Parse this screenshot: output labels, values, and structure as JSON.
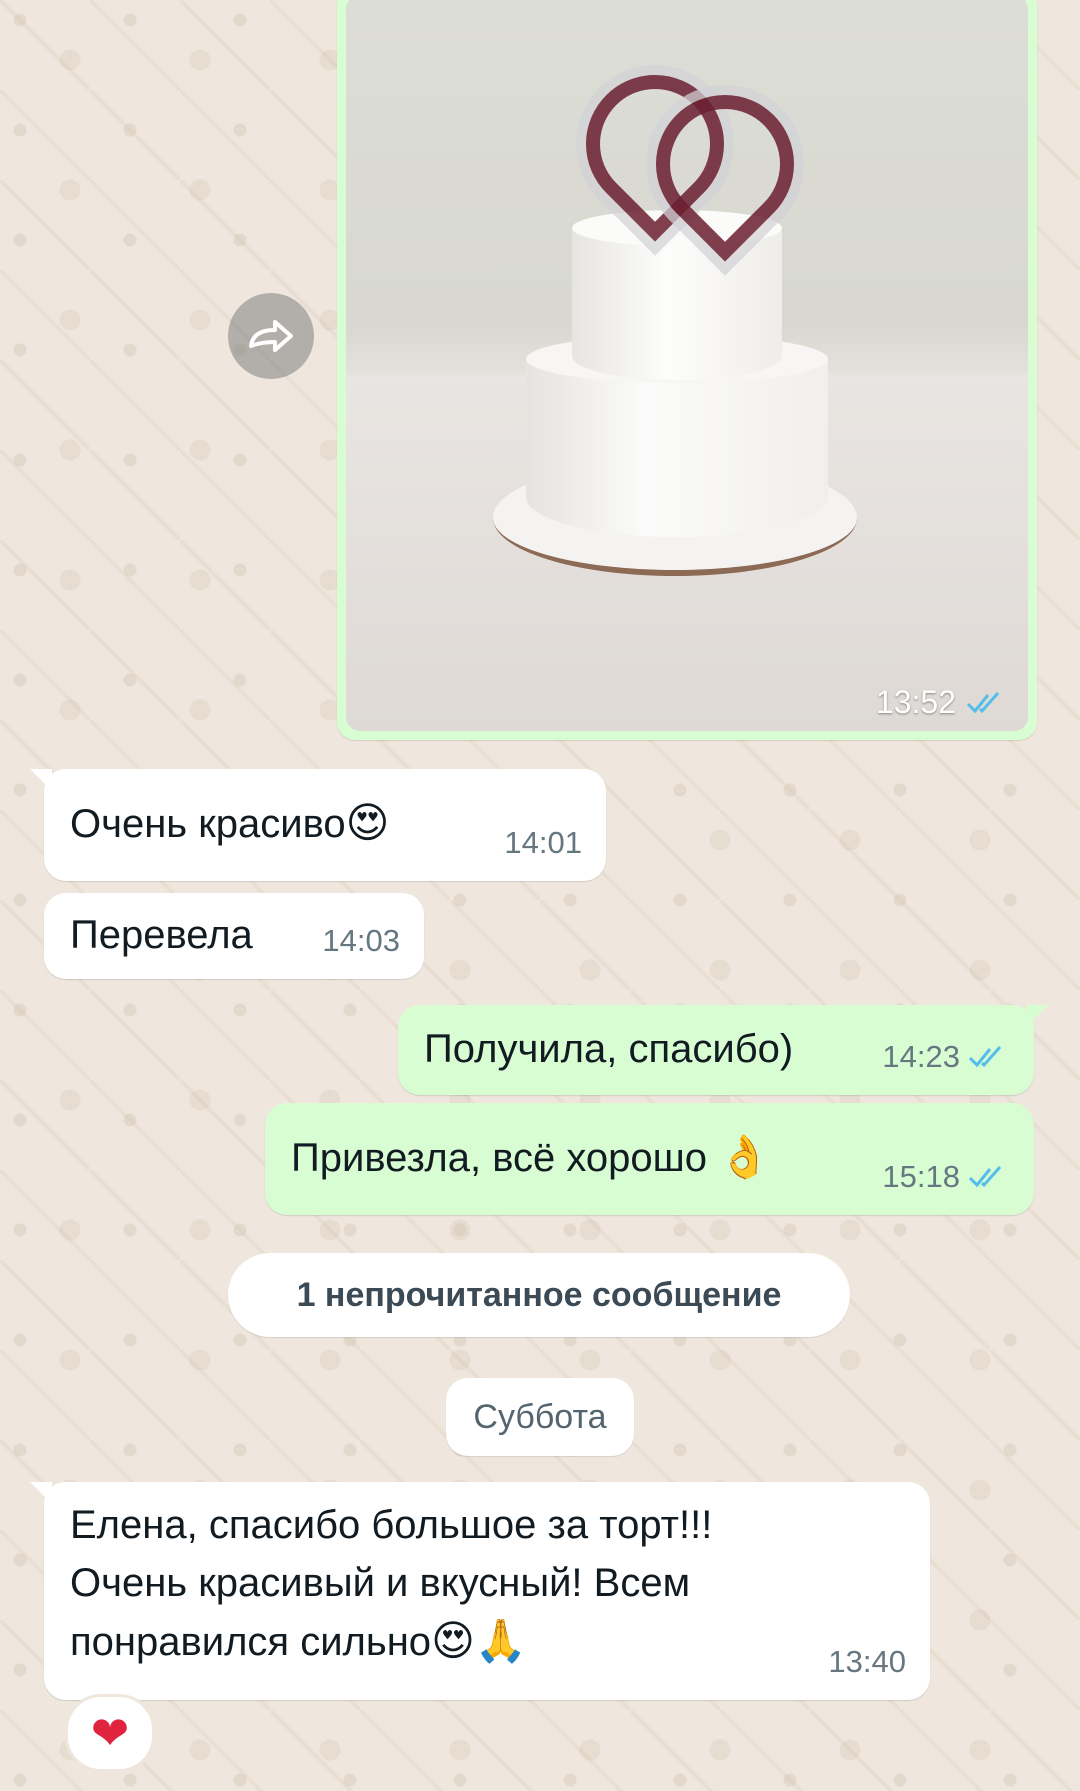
{
  "photo_message": {
    "time": "13:52",
    "status": "read",
    "status_icon": "double-check-icon",
    "status_color": "#53bdeb"
  },
  "forward_icon": "forward-icon",
  "messages": [
    {
      "id": "m1",
      "direction": "incoming",
      "text": "Очень красиво",
      "emoji": "😍",
      "time": "14:01"
    },
    {
      "id": "m2",
      "direction": "incoming",
      "text": "Перевела",
      "time": "14:03"
    },
    {
      "id": "m3",
      "direction": "outgoing",
      "text": "Получила, спасибо)",
      "time": "14:23",
      "status": "read"
    },
    {
      "id": "m4",
      "direction": "outgoing",
      "text": "Привезла, всё хорошо",
      "emoji": "👌",
      "time": "15:18",
      "status": "read"
    },
    {
      "id": "m5",
      "direction": "incoming",
      "lines": [
        "Елена, спасибо большое за торт!!!",
        "Очень красивый и вкусный! Всем",
        "понравился сильно"
      ],
      "emoji": "😍🙏",
      "time": "13:40",
      "reaction": "❤"
    }
  ],
  "unread_banner": "1 непрочитанное сообщение",
  "date_separator": "Суббота",
  "colors": {
    "chat_background": "#efe7dd",
    "outgoing_bubble": "#d9fdd3",
    "incoming_bubble": "#ffffff",
    "read_check": "#53bdeb"
  }
}
